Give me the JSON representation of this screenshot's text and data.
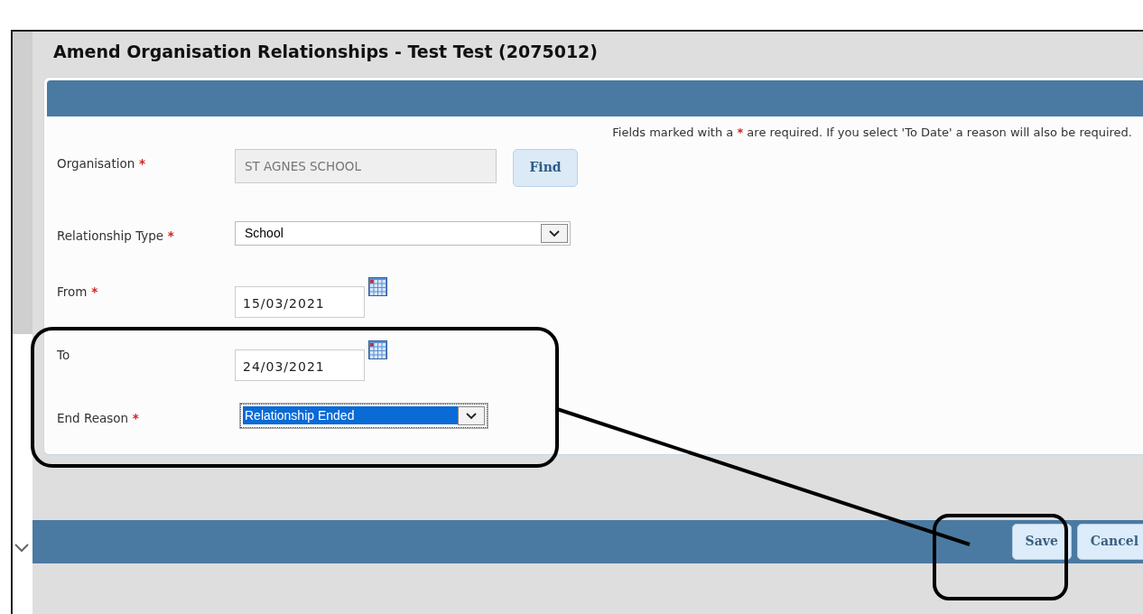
{
  "title": "Amend Organisation Relationships - Test Test (2075012)",
  "note": {
    "before": "Fields marked with a",
    "mark": "*",
    "after": "are required. If you select 'To Date' a reason will also be required."
  },
  "fields": [
    {
      "kind": "text",
      "label": "Organisation",
      "marker": "*",
      "value": "ST AGNES SCHOOL",
      "readonly": true,
      "button": "Find"
    },
    {
      "kind": "select",
      "label": "Relationship Type",
      "marker": "*",
      "value": "School",
      "focused": false
    },
    {
      "kind": "date",
      "label": "From",
      "marker": "*",
      "value": "15/03/2021"
    },
    {
      "kind": "date",
      "label": "To",
      "value": "24/03/2021"
    },
    {
      "kind": "select",
      "label": "End Reason",
      "marker": "*",
      "value": "Relationship Ended",
      "focused": true
    }
  ],
  "footer_buttons": [
    "Save",
    "Cancel"
  ]
}
